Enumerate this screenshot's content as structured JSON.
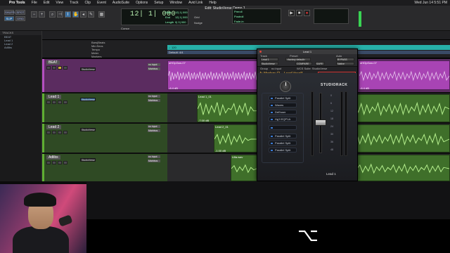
{
  "menubar": {
    "app": "Pro Tools",
    "items": [
      "File",
      "Edit",
      "View",
      "Track",
      "Clip",
      "Event",
      "AudioSuite",
      "Options",
      "Setup",
      "Window",
      "Avid Link",
      "Help"
    ],
    "clock": "Wed Jun 14  5:51 PM"
  },
  "transport": {
    "window_title": "Edit: StudioVerse Demo 1",
    "modes": [
      "SHUFFLE",
      "SPOT",
      "SLIP",
      "GRID"
    ],
    "counter_main": "12| 1| 000",
    "counter_labels": [
      "Start",
      "End",
      "Length"
    ],
    "counter_values": [
      "12| 1| 000",
      "12| 1| 000",
      "0| 0| 000"
    ],
    "cursor_label": "Cursor",
    "grid_label": "Grid",
    "nudge_label": "Nudge",
    "pre_roll": "Preroll",
    "post_roll": "Postroll",
    "fade_in": "Fade-in"
  },
  "tracks_panel": {
    "header": "TRACKS",
    "items": [
      "BEAT",
      "Lead 1",
      "Lead 2",
      "Adlibs"
    ]
  },
  "ruler": {
    "rows": [
      "Bars|Beats",
      "Min:Secs",
      "Tempo",
      "Meter",
      "Markers"
    ],
    "tempo_value": "♩120",
    "meter_value": "Default: 4/4"
  },
  "tracks": [
    {
      "name": "BEAT",
      "color": "#9b3fa8",
      "insert": "StudioVerse",
      "io_in": "no input",
      "io_out": "Mainbus",
      "clips": [
        "aHOpGan-07",
        "aHOpGan-07"
      ],
      "volume": "-6.4 dB"
    },
    {
      "name": "Lead 1",
      "color": "#4a8a2a",
      "insert": "StudioVerse",
      "io_in": "no input",
      "io_out": "Mainbus",
      "clips": [
        "Lead 1_01"
      ],
      "volume": "-7.00 dB"
    },
    {
      "name": "Lead 2",
      "color": "#4a8a2a",
      "insert": "StudioVerse",
      "io_in": "no input",
      "io_out": "Mainbus",
      "clips": [
        "Lead 2_01"
      ],
      "volume": "-1.00 dB"
    },
    {
      "name": "Adlibs",
      "color": "#4a8a2a",
      "insert": "StudioVerse",
      "io_in": "no input",
      "io_out": "Mainbus",
      "clips": [
        "Lilla.wav"
      ],
      "volume": "-1.00 dB"
    }
  ],
  "plugin": {
    "title": "Lead 1",
    "track_label": "Track",
    "preset_label": "Preset",
    "auto_label": "Auto",
    "track_value": "Lead 1",
    "preset_value": "<factory default>",
    "insert_value": "StudioVerse",
    "compare": "COMPARE",
    "safe": "SAFE",
    "bypass": "BYPASS",
    "native": "Native",
    "group_label": "Group",
    "no_input": "no input",
    "wcs_label": "WCS Suite: StudioVerse",
    "preset_name": "A: Modern Cl... Lead Vocal*",
    "search_placeholder": "StudioVerse",
    "logo": "STUDIORACK",
    "rack_slots": [
      "Parallel Split",
      "Waves",
      "DeEsser",
      "Hg'll EQP1A",
      "",
      "Parallel Split",
      "Parallel Split",
      "Parallel Split"
    ],
    "channel_name": "Lead 1",
    "scale": [
      "0",
      "6",
      "12",
      "18",
      "24",
      "30",
      "36",
      "48"
    ]
  },
  "overlay": {
    "key_glyph": "⌥"
  }
}
